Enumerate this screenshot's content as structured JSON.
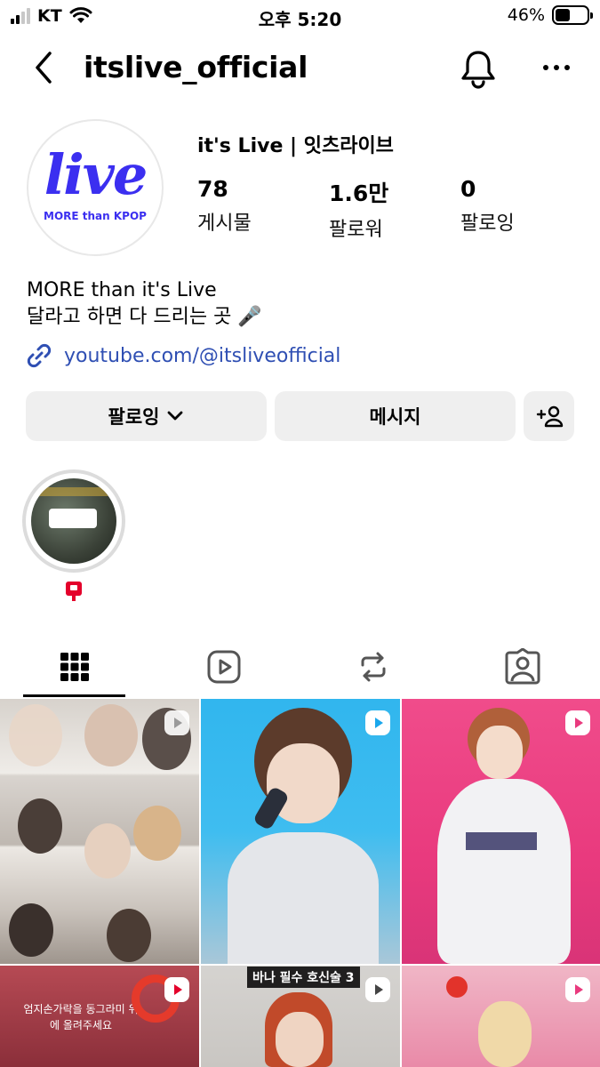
{
  "status_bar": {
    "carrier": "KT",
    "time": "오후 5:20",
    "battery": "46%",
    "battery_level": 0.46
  },
  "header": {
    "username": "itslive_official"
  },
  "profile": {
    "avatar_logo": "live",
    "avatar_tagline": "MORE than KPOP",
    "display_name": "it's Live | 잇츠라이브",
    "stats": [
      {
        "value": "78",
        "label": "게시물"
      },
      {
        "value": "1.6만",
        "label": "팔로워"
      },
      {
        "value": "0",
        "label": "팔로잉"
      }
    ],
    "bio_line1": "MORE than it's Live",
    "bio_line2": "달라고 하면 다 드리는 곳 🎤",
    "link": "youtube.com/@itsliveofficial"
  },
  "actions": {
    "follow_label": "팔로잉",
    "message_label": "메시지"
  },
  "tabs": [
    {
      "icon": "grid-icon"
    },
    {
      "icon": "reels-icon"
    },
    {
      "icon": "repost-icon"
    },
    {
      "icon": "tagged-icon"
    }
  ],
  "grid": {
    "cell_captions": {
      "row2_col2": "바나 필수 호신술 3",
      "row2_col1": "엄지손가락을 동그라미 위에 올려주세요"
    }
  },
  "colors": {
    "brand_blue": "#3b2ff0",
    "link_blue": "#2f4fb3",
    "button_bg": "#efefef",
    "reel_badge_red": "#e4002b"
  }
}
